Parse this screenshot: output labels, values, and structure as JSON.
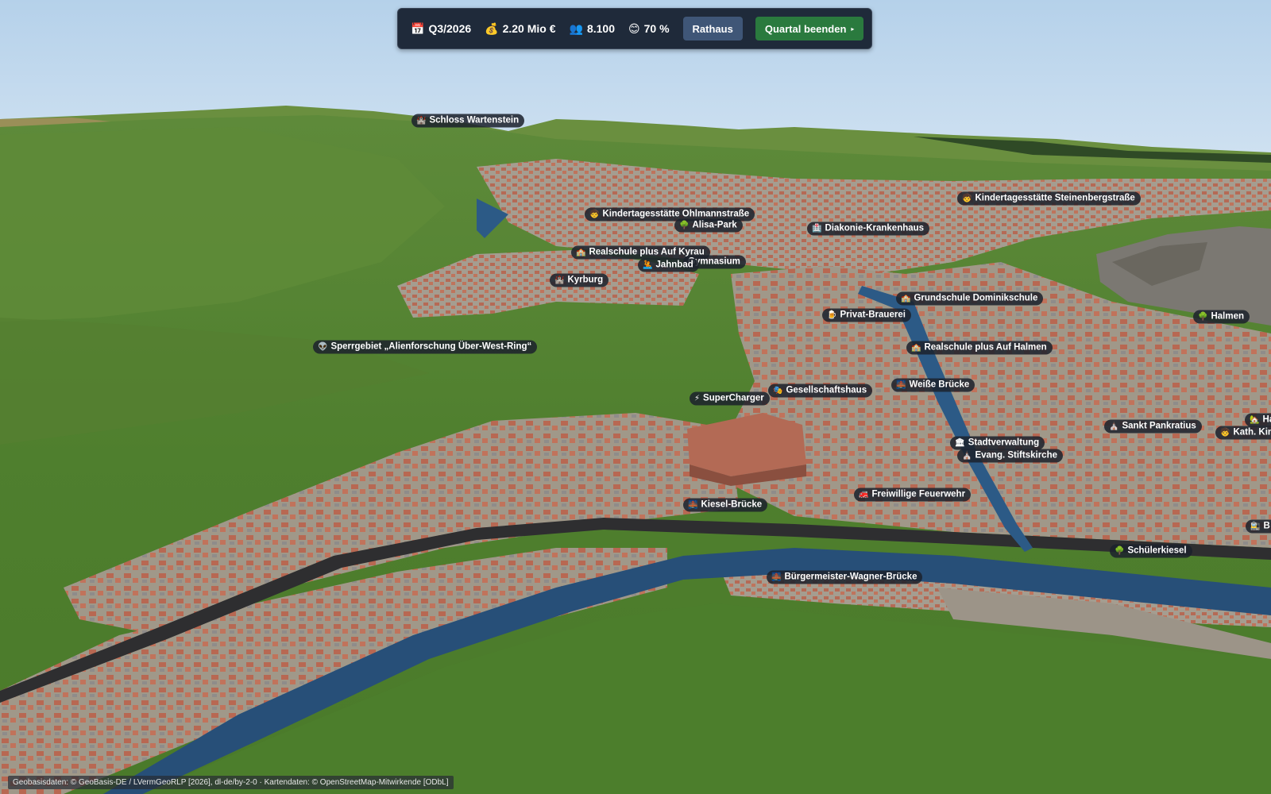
{
  "hud": {
    "quarter": {
      "icon": "calendar-icon",
      "glyph": "📅",
      "value": "Q3/2026"
    },
    "budget": {
      "icon": "money-bag-icon",
      "glyph": "💰",
      "value": "2.20 Mio €"
    },
    "population": {
      "icon": "people-icon",
      "glyph": "👥",
      "value": "8.100"
    },
    "satisfaction": {
      "icon": "smiley-icon",
      "glyph": "😊",
      "value": "70 %"
    },
    "rathaus_label": "Rathaus",
    "end_quarter_label": "Quartal beenden",
    "end_quarter_arrow": "▸"
  },
  "pois": [
    {
      "key": "schloss-wartenstein",
      "glyph": "🏰",
      "icon": "castle-icon",
      "label": "Schloss Wartenstein"
    },
    {
      "key": "kita-steinenbergstrasse",
      "glyph": "🧒",
      "icon": "child-icon",
      "label": "Kindertagesstätte Steinenbergstraße"
    },
    {
      "key": "kita-ohlmannstrasse",
      "glyph": "🧒",
      "icon": "child-icon",
      "label": "Kindertagesstätte Ohlmannstraße"
    },
    {
      "key": "alisa-park",
      "glyph": "🌳",
      "icon": "tree-icon",
      "label": "Alisa-Park"
    },
    {
      "key": "diakonie-krankenhaus",
      "glyph": "🏥",
      "icon": "hospital-icon",
      "label": "Diakonie-Krankenhaus"
    },
    {
      "key": "realschule-kyrau",
      "glyph": "🏫",
      "icon": "school-icon",
      "label": "Realschule plus Auf Kyrau"
    },
    {
      "key": "gymnasium",
      "glyph": "",
      "icon": "school-icon",
      "label": "Gymnasium"
    },
    {
      "key": "jahnbad",
      "glyph": "🤽",
      "icon": "swimming-icon",
      "label": "Jahnbad"
    },
    {
      "key": "kyrburg",
      "glyph": "🏰",
      "icon": "castle-icon",
      "label": "Kyrburg"
    },
    {
      "key": "grundschule-dominikschule",
      "glyph": "🏫",
      "icon": "school-icon",
      "label": "Grundschule Dominikschule"
    },
    {
      "key": "privat-brauerei",
      "glyph": "🍺",
      "icon": "beer-icon",
      "label": "Privat-Brauerei"
    },
    {
      "key": "halmen",
      "glyph": "🌳",
      "icon": "tree-icon",
      "label": "Halmen"
    },
    {
      "key": "sperrgebiet",
      "glyph": "👽",
      "icon": "alien-icon",
      "label": "Sperrgebiet „Alienforschung Über-West-Ring“"
    },
    {
      "key": "realschule-halmen",
      "glyph": "🏫",
      "icon": "school-icon",
      "label": "Realschule plus Auf Halmen"
    },
    {
      "key": "weisse-bruecke",
      "glyph": "🌉",
      "icon": "bridge-icon",
      "label": "Weiße Brücke"
    },
    {
      "key": "gesellschaftshaus",
      "glyph": "🎭",
      "icon": "theater-icon",
      "label": "Gesellschaftshaus"
    },
    {
      "key": "supercharger",
      "glyph": "⚡",
      "icon": "lightning-icon",
      "label": "SuperCharger"
    },
    {
      "key": "sankt-pankratius",
      "glyph": "⛪",
      "icon": "church-icon",
      "label": "Sankt Pankratius"
    },
    {
      "key": "ha-partial",
      "glyph": "🏡",
      "icon": "house-icon",
      "label": "Ha"
    },
    {
      "key": "kath-kin-partial",
      "glyph": "🧒",
      "icon": "child-icon",
      "label": "Kath. Kin"
    },
    {
      "key": "stadtverwaltung",
      "glyph": "🏛",
      "icon": "government-building-icon",
      "label": "Stadtverwaltung"
    },
    {
      "key": "evang-stiftskirche",
      "glyph": "⛪",
      "icon": "church-icon",
      "label": "Evang. Stiftskirche"
    },
    {
      "key": "freiwillige-feuerwehr",
      "glyph": "🚒",
      "icon": "fire-truck-icon",
      "label": "Freiwillige Feuerwehr"
    },
    {
      "key": "kiesel-bruecke",
      "glyph": "🌉",
      "icon": "bridge-icon",
      "label": "Kiesel-Brücke"
    },
    {
      "key": "b-partial",
      "glyph": "🚉",
      "icon": "station-icon",
      "label": "B"
    },
    {
      "key": "schuelerkiesel",
      "glyph": "🌳",
      "icon": "tree-icon",
      "label": "Schülerkiesel"
    },
    {
      "key": "buergermeister-wagner-bruecke",
      "glyph": "🌉",
      "icon": "bridge-icon",
      "label": "Bürgermeister-Wagner-Brücke"
    }
  ],
  "attribution": "Geobasisdaten: © GeoBasis-DE / LVermGeoRLP [2026], dl-de/by-2-0 · Kartendaten: © OpenStreetMap-Mitwirkende [ODbL]"
}
